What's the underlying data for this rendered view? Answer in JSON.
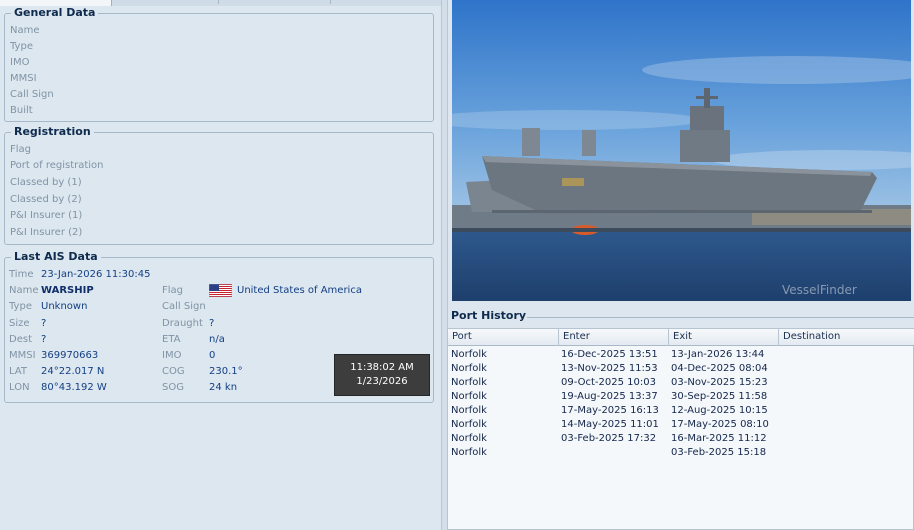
{
  "general": {
    "title": "General Data",
    "fields": [
      "Name",
      "Type",
      "IMO",
      "MMSI",
      "Call Sign",
      "Built"
    ]
  },
  "registration": {
    "title": "Registration",
    "fields": [
      "Flag",
      "Port of registration",
      "Classed by (1)",
      "Classed by (2)",
      "P&I Insurer (1)",
      "P&I Insurer (2)"
    ]
  },
  "ais": {
    "title": "Last AIS Data",
    "time_label": "Time",
    "time_value": "23-Jan-2026 11:30:45",
    "name_label": "Name",
    "name_value": "WARSHIP",
    "type_label": "Type",
    "type_value": "Unknown",
    "size_label": "Size",
    "size_value": "?",
    "dest_label": "Dest",
    "dest_value": "?",
    "mmsi_label": "MMSI",
    "mmsi_value": "369970663",
    "lat_label": "LAT",
    "lat_value": "24°22.017 N",
    "lon_label": "LON",
    "lon_value": "80°43.192 W",
    "flag_label": "Flag",
    "flag_value": "United States of America",
    "flag_icon": "us-flag-icon",
    "callsign_label": "Call Sign",
    "callsign_value": "",
    "draught_label": "Draught",
    "draught_value": "?",
    "eta_label": "ETA",
    "eta_value": "n/a",
    "imo_label": "IMO",
    "imo_value": "0",
    "cog_label": "COG",
    "cog_value": "230.1°",
    "sog_label": "SOG",
    "sog_value": "24 kn"
  },
  "clock": {
    "time": "11:38:02 AM",
    "date": "1/23/2026"
  },
  "photo": {
    "watermark": "VesselFinder"
  },
  "port_history": {
    "title": "Port History",
    "columns": [
      "Port",
      "Enter",
      "Exit",
      "Destination"
    ],
    "rows": [
      {
        "port": "Norfolk",
        "enter": "16-Dec-2025 13:51",
        "exit": "13-Jan-2026 13:44",
        "destination": ""
      },
      {
        "port": "Norfolk",
        "enter": "13-Nov-2025 11:53",
        "exit": "04-Dec-2025 08:04",
        "destination": ""
      },
      {
        "port": "Norfolk",
        "enter": "09-Oct-2025 10:03",
        "exit": "03-Nov-2025 15:23",
        "destination": ""
      },
      {
        "port": "Norfolk",
        "enter": "19-Aug-2025 13:37",
        "exit": "30-Sep-2025 11:58",
        "destination": ""
      },
      {
        "port": "Norfolk",
        "enter": "17-May-2025 16:13",
        "exit": "12-Aug-2025 10:15",
        "destination": ""
      },
      {
        "port": "Norfolk",
        "enter": "14-May-2025 11:01",
        "exit": "17-May-2025 08:10",
        "destination": ""
      },
      {
        "port": "Norfolk",
        "enter": "03-Feb-2025 17:32",
        "exit": "16-Mar-2025 11:12",
        "destination": ""
      },
      {
        "port": "Norfolk",
        "enter": "",
        "exit": "03-Feb-2025 15:18",
        "destination": ""
      }
    ]
  },
  "colors": {
    "panel_bg": "#dce7ef",
    "value_text": "#143f85",
    "label_text": "#8193a5",
    "clock_bg": "#3d3d3d"
  }
}
